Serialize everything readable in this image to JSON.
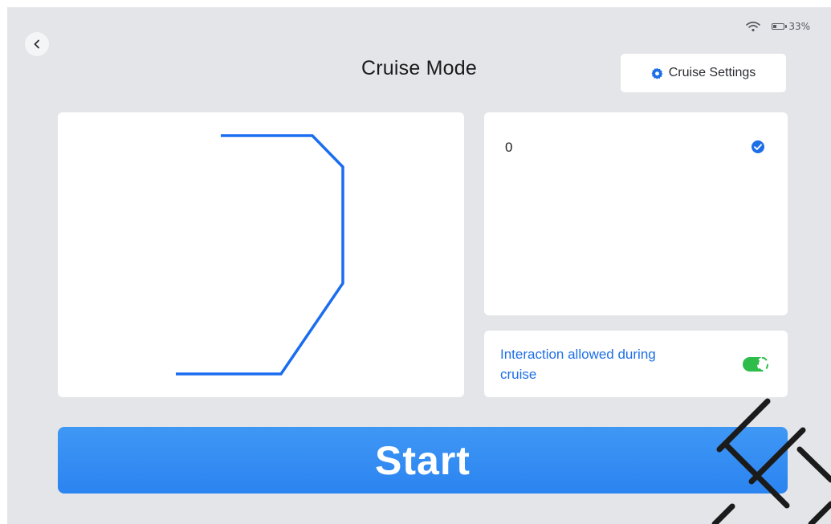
{
  "status_bar": {
    "battery_text": "33%",
    "battery_level": 0.33
  },
  "header": {
    "back_icon": "chevron-left-icon",
    "title": "Cruise Mode",
    "settings_button_icon": "gear-icon",
    "settings_button_label": "Cruise Settings"
  },
  "route_list": {
    "items": [
      {
        "label": "0",
        "selected": true,
        "icon": "check-circle-icon"
      }
    ]
  },
  "interaction_setting": {
    "label": "Interaction allowed during cruise",
    "enabled": true
  },
  "start_button": {
    "label": "Start"
  },
  "colors": {
    "accent": "#1e6fe6",
    "start_button": "#2b84f0",
    "toggle_on": "#2ebd4b",
    "background": "#e3e5e8",
    "route_line": "#1a6cf0"
  }
}
